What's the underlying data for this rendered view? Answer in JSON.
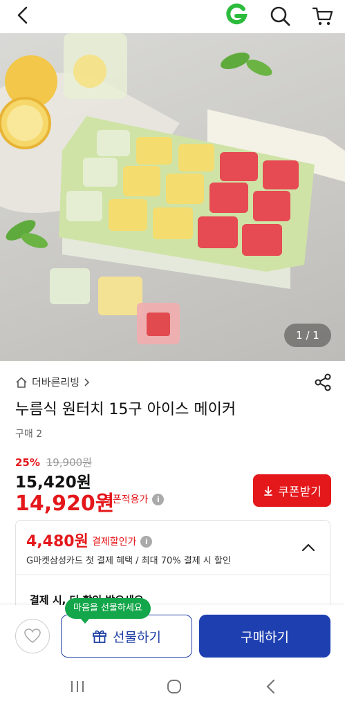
{
  "header": {
    "back_icon": "chevron-left-icon",
    "logo_letter": "G",
    "logo_color": "#2dbb3d",
    "search_icon": "search-icon",
    "cart_icon": "cart-icon"
  },
  "gallery": {
    "counter": "1 / 1"
  },
  "product": {
    "brand": "더바른리빙",
    "title": "누름식 원터치 15구 아이스 메이커",
    "purchase_count": "구매 2"
  },
  "pricing": {
    "discount_rate": "25%",
    "original_price": "19,900원",
    "sale_price": "15,420원",
    "coupon_price": "14,920원",
    "coupon_applied_label": "쿠폰적용가",
    "coupon_button": "쿠폰받기",
    "accent_color": "#e4171b"
  },
  "payment_card": {
    "price": "4,480원",
    "label": "결제할인가",
    "benefit": "G마켓삼성카드 첫 결제 혜택 / 최대 70% 결제 시 할인",
    "hint": "결제 시, 더 할인 받으세요"
  },
  "actions": {
    "gift_tooltip": "마음을 선물하세요",
    "gift_button": "선물하기",
    "buy_button": "구매하기",
    "primary_color": "#1d3fb0"
  }
}
